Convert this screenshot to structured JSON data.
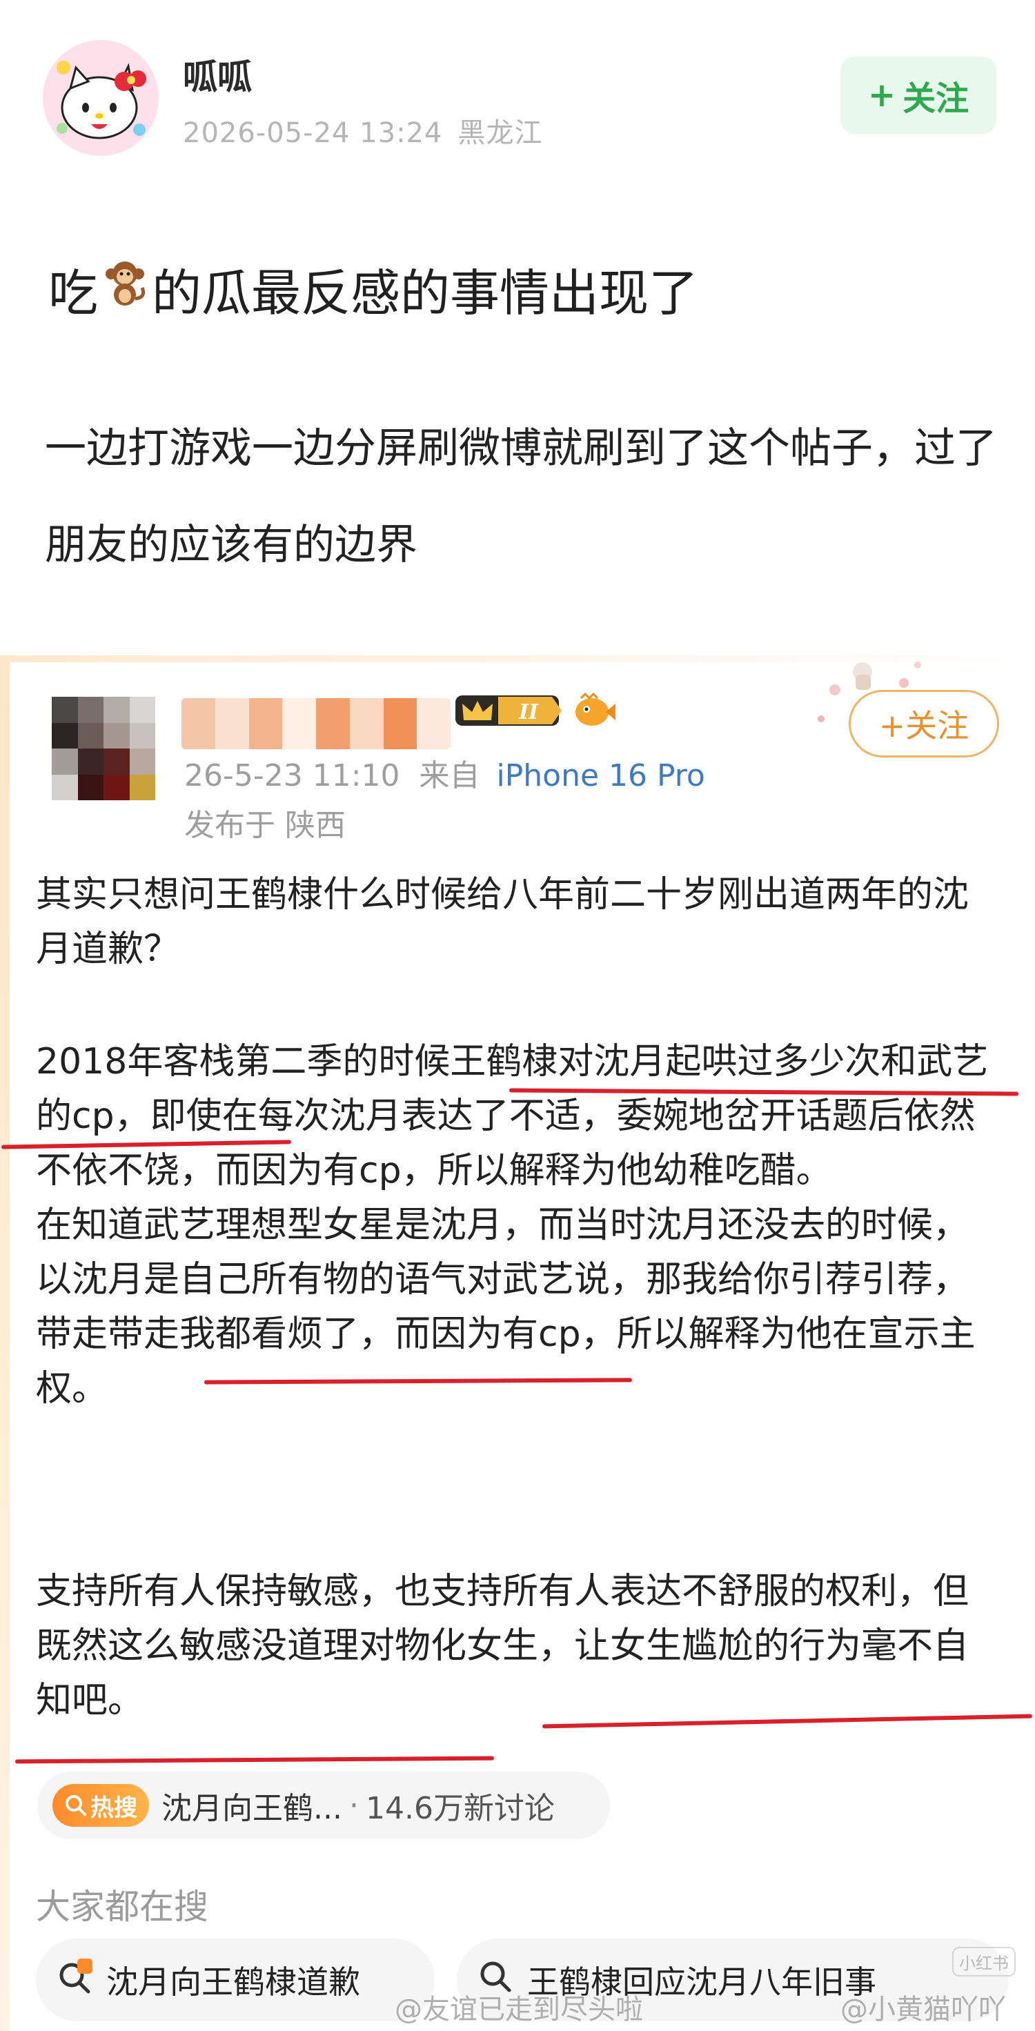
{
  "post": {
    "username": "呱呱",
    "date": "2026-05-24 13:24",
    "location": "黑龙江",
    "follow_plus": "+",
    "follow_label": "关注",
    "title_before": "吃",
    "title_emoji": "🐒",
    "title_after": "的瓜最反感的事情出现了",
    "body": "一边打游戏一边分屏刷微博就刷到了这个帖子，过了朋友的应该有的边界"
  },
  "embedded": {
    "badge_level": "II",
    "follow_label": "+关注",
    "date": "26-5-23 11:10",
    "source_prefix": "来自",
    "device": "iPhone 16 Pro",
    "location": "发布于 陕西",
    "paragraph1": "其实只想问王鹤棣什么时候给八年前二十岁刚出道两年的沈月道歉？",
    "paragraph2_line1": "2018年客栈第二季的时候王鹤棣对沈月起哄过多少次和武艺的cp，即使在每次沈月表达了不适，委婉地岔开话题后依然不依不饶，而因为有cp，所以解释为他幼稚吃醋。",
    "paragraph2_line2": "在知道武艺理想型女星是沈月，而当时沈月还没去的时候，以沈月是自己所有物的语气对武艺说，那我给你引荐引荐，带走带走我都看烦了，而因为有cp，所以解释为他在宣示主权。",
    "paragraph3": "支持所有人保持敏感，也支持所有人表达不舒服的权利，但既然这么敏感没道理对物化女生，让女生尴尬的行为毫不自知吧。",
    "hot_badge": "热搜",
    "hot_topic": "沈月向王鹤...",
    "hot_count": "14.6万新讨论",
    "search_heading": "大家都在搜",
    "search_items": [
      "沈月向王鹤棣道歉",
      "王鹤棣回应沈月八年旧事"
    ]
  },
  "watermarks": [
    "@友谊已走到尽头啦",
    "@小黄猫吖吖"
  ],
  "corner_mark": "小红书",
  "colors": {
    "follow_green": "#2fa84f",
    "follow_orange": "#e7912f",
    "underline_red": "#d9212c",
    "device_blue": "#3d7ac3",
    "hot_orange": "#ff8a2b"
  }
}
